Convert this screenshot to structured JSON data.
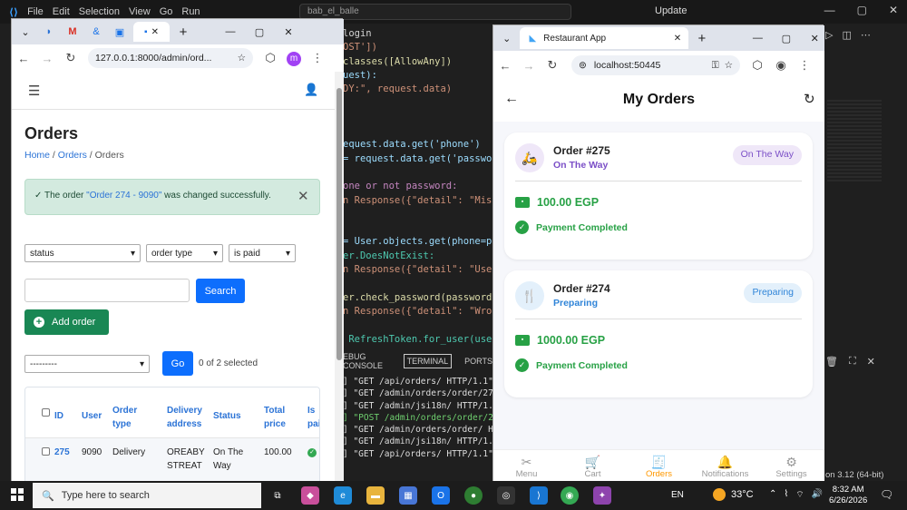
{
  "vscode": {
    "menu": [
      "File",
      "Edit",
      "Selection",
      "View",
      "Go",
      "Run"
    ],
    "search_text": "bab_el_balle",
    "update_label": "Update",
    "editor_lines": [
      {
        "t": "login",
        "c": ""
      },
      {
        "t": "OST'])",
        "c": "str"
      },
      {
        "t": "classes([AllowAny])",
        "c": "fn"
      },
      {
        "t": "uest):",
        "c": "var"
      },
      {
        "t": "DY:\", request.data)",
        "c": "str"
      },
      {
        "t": "",
        "c": ""
      },
      {
        "t": "",
        "c": ""
      },
      {
        "t": "",
        "c": ""
      },
      {
        "t": "equest.data.get('phone')",
        "c": "var"
      },
      {
        "t": "= request.data.get('password'",
        "c": "var"
      },
      {
        "t": "",
        "c": ""
      },
      {
        "t": "one or not password:",
        "c": "kw"
      },
      {
        "t": "n Response({\"detail\": \"Missin",
        "c": "str"
      },
      {
        "t": "",
        "c": ""
      },
      {
        "t": "",
        "c": ""
      },
      {
        "t": "= User.objects.get(phone=phon",
        "c": "var"
      },
      {
        "t": "er.DoesNotExist:",
        "c": "cls"
      },
      {
        "t": "n Response({\"detail\": \"User n",
        "c": "str"
      },
      {
        "t": "",
        "c": ""
      },
      {
        "t": "er.check_password(password):",
        "c": "fn"
      },
      {
        "t": "n Response({\"detail\": \"Wrong",
        "c": "str"
      },
      {
        "t": "",
        "c": ""
      },
      {
        "t": " RefreshToken.for_user(user)",
        "c": "cls"
      }
    ],
    "panel_tabs": [
      "EBUG CONSOLE",
      "TERMINAL",
      "PORTS"
    ],
    "terminal_lines": [
      {
        "t": "] \"GET /api/orders/ HTTP/1.1\" 20",
        "ok": false
      },
      {
        "t": "] \"GET /admin/orders/order/274/c",
        "ok": false
      },
      {
        "t": "] \"GET /admin/jsi18n/ HTTP/1.1\"",
        "ok": false
      },
      {
        "t": "] \"POST /admin/orders/order/274/",
        "ok": true
      },
      {
        "t": "] \"GET /admin/orders/order/ HTTP",
        "ok": false
      },
      {
        "t": "] \"GET /admin/jsi18n/ HTTP/1.1\"",
        "ok": false
      },
      {
        "t": "] \"GET /api/orders/ HTTP/1.1\" 20",
        "ok": false
      }
    ],
    "status_text": "on 3.12 (64-bit)"
  },
  "browser1": {
    "url": "127.0.0.1:8000/admin/ord...",
    "profile_letter": "m",
    "admin": {
      "title": "Orders",
      "breadcrumb": [
        "Home",
        "Orders",
        "Orders"
      ],
      "message_prefix": "The order ",
      "message_link": "\"Order 274 - 9090\"",
      "message_suffix": " was changed successfully.",
      "filters": [
        "status",
        "order type",
        "is paid"
      ],
      "search_label": "Search",
      "add_label": "Add order",
      "action_placeholder": "---------",
      "go_label": "Go",
      "selected_text": "0 of 2 selected",
      "columns": [
        "ID",
        "User",
        "Order type",
        "Delivery address",
        "Status",
        "Total price",
        "Is paid"
      ],
      "rows": [
        {
          "id": "275",
          "user": "9090",
          "type": "Delivery",
          "address": "OREABY STREAT",
          "status": "On The Way",
          "total": "100.00"
        }
      ]
    }
  },
  "browser2": {
    "tab_title": "Restaurant App",
    "url": "localhost:50445",
    "app": {
      "title": "My Orders",
      "orders": [
        {
          "title": "Order #275",
          "status": "On The Way",
          "badge": "On The Way",
          "price": "100.00 EGP",
          "payment": "Payment Completed",
          "color": "#7b4fc7",
          "bg": "#efe7f8"
        },
        {
          "title": "Order #274",
          "status": "Preparing",
          "badge": "Preparing",
          "price": "1000.00 EGP",
          "payment": "Payment Completed",
          "color": "#2f84d8",
          "bg": "#e3f0fb"
        }
      ],
      "nav": [
        {
          "label": "Menu",
          "icon": "✂",
          "active": false
        },
        {
          "label": "Cart",
          "icon": "🛒",
          "active": false
        },
        {
          "label": "Orders",
          "icon": "🧾",
          "active": true
        },
        {
          "label": "Notifications",
          "icon": "🔔",
          "active": false
        },
        {
          "label": "Settings",
          "icon": "⚙",
          "active": false
        }
      ]
    }
  },
  "taskbar": {
    "search_placeholder": "Type here to search",
    "lang": "EN",
    "temp": "33°C",
    "time": "8:32 AM",
    "date": "6/26/2026"
  }
}
